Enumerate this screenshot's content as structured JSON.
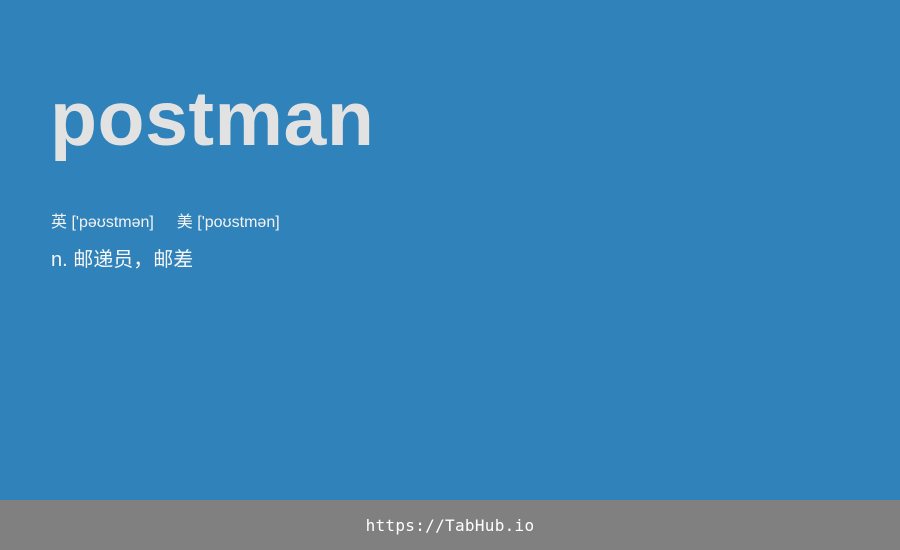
{
  "word": "postman",
  "pronunciation": {
    "uk_label": "英",
    "uk_ipa": "['pəʊstmən]",
    "us_label": "美",
    "us_ipa": "['poʊstmən]"
  },
  "definition": {
    "pos": "n.",
    "meaning": "邮递员，邮差"
  },
  "footer": {
    "link_text": "https://TabHub.io"
  },
  "colors": {
    "background": "#2f82ba",
    "footer_background": "#808080",
    "word_text": "#e2e2e2"
  }
}
